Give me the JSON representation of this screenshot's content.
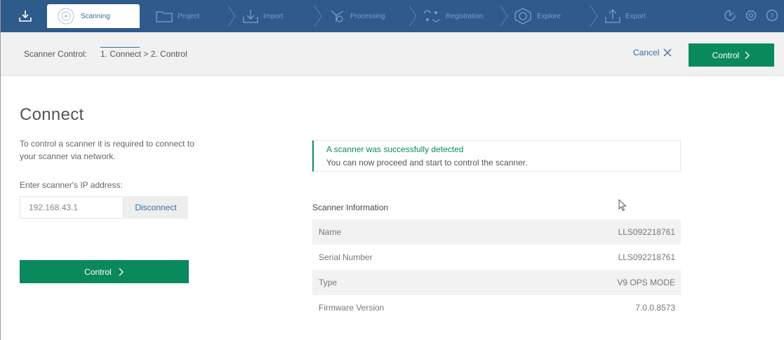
{
  "nav": {
    "steps": [
      {
        "label": "Scanning",
        "icon": "scanner-icon",
        "active": true
      },
      {
        "label": "Project",
        "icon": "folder-icon"
      },
      {
        "label": "Import",
        "icon": "import-icon"
      },
      {
        "label": "Processing",
        "icon": "processing-icon"
      },
      {
        "label": "Registration",
        "icon": "registration-icon"
      },
      {
        "label": "Explore",
        "icon": "explore-icon"
      },
      {
        "label": "Export",
        "icon": "export-icon"
      }
    ],
    "right_icons": [
      "sync-icon",
      "settings-icon",
      "help-icon"
    ],
    "colors": {
      "bar": "#2e5a8c",
      "active_text": "#3a6b9e",
      "inactive_text": "#7f9ec2"
    }
  },
  "subheader": {
    "label": "Scanner Control:",
    "crumb1": "1. Connect",
    "separator": ">",
    "crumb2": "2. Control",
    "cancel": "Cancel",
    "control": "Control"
  },
  "connect": {
    "title": "Connect",
    "description": "To control a scanner it is required to connect to your scanner via network.",
    "ip_label": "Enter scanner's IP address:",
    "ip_value": "192.168.43.1",
    "disconnect": "Disconnect",
    "control": "Control"
  },
  "alert": {
    "title": "A scanner was successfully detected",
    "message": "You can now proceed and start to control the scanner."
  },
  "scanner_info": {
    "title": "Scanner Information",
    "rows": [
      {
        "label": "Name",
        "value": "LLS092218761"
      },
      {
        "label": "Serial Number",
        "value": "LLS092218761"
      },
      {
        "label": "Type",
        "value": "V9 OPS MODE"
      },
      {
        "label": "Firmware Version",
        "value": "7.0.0.8573"
      }
    ]
  },
  "accent_color": "#0a8a5c"
}
